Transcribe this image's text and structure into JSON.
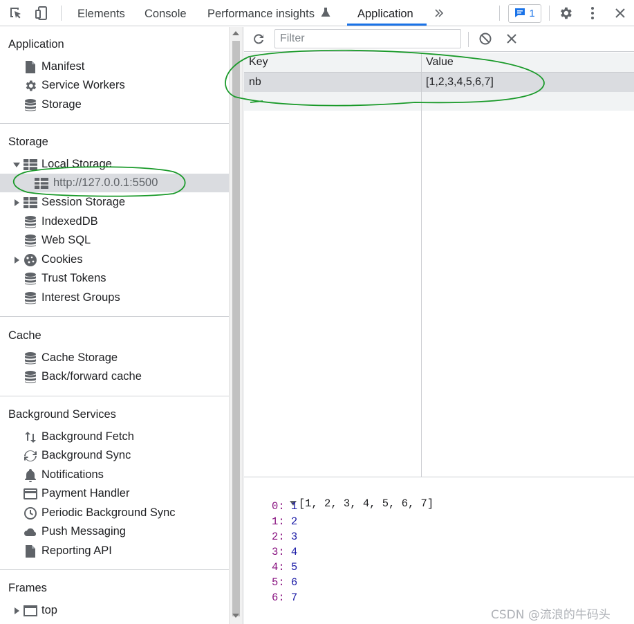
{
  "toolbar": {
    "tabs": [
      "Elements",
      "Console",
      "Performance insights",
      "Application"
    ],
    "active_tab": "Application",
    "issues_count": "1",
    "accent": "#1a73e8"
  },
  "sidebar": {
    "application": {
      "title": "Application",
      "items": [
        "Manifest",
        "Service Workers",
        "Storage"
      ]
    },
    "storage": {
      "title": "Storage",
      "local_storage": "Local Storage",
      "local_origin": "http://127.0.0.1:5500",
      "session_storage": "Session Storage",
      "indexeddb": "IndexedDB",
      "web_sql": "Web SQL",
      "cookies": "Cookies",
      "trust_tokens": "Trust Tokens",
      "interest_groups": "Interest Groups"
    },
    "cache": {
      "title": "Cache",
      "items": [
        "Cache Storage",
        "Back/forward cache"
      ]
    },
    "background": {
      "title": "Background Services",
      "items": [
        "Background Fetch",
        "Background Sync",
        "Notifications",
        "Payment Handler",
        "Periodic Background Sync",
        "Push Messaging",
        "Reporting API"
      ]
    },
    "frames": {
      "title": "Frames",
      "top": "top"
    }
  },
  "main": {
    "filter_placeholder": "Filter",
    "columns": {
      "key": "Key",
      "value": "Value"
    },
    "rows": [
      {
        "key": "nb",
        "value": "[1,2,3,4,5,6,7]"
      }
    ],
    "preview": {
      "header": "[1, 2, 3, 4, 5, 6, 7]",
      "entries": [
        {
          "k": "0",
          "v": "1"
        },
        {
          "k": "1",
          "v": "2"
        },
        {
          "k": "2",
          "v": "3"
        },
        {
          "k": "3",
          "v": "4"
        },
        {
          "k": "4",
          "v": "5"
        },
        {
          "k": "5",
          "v": "6"
        },
        {
          "k": "6",
          "v": "7"
        }
      ]
    }
  },
  "watermark": "CSDN @流浪的牛码头",
  "annotation_color": "#1a9a2a"
}
